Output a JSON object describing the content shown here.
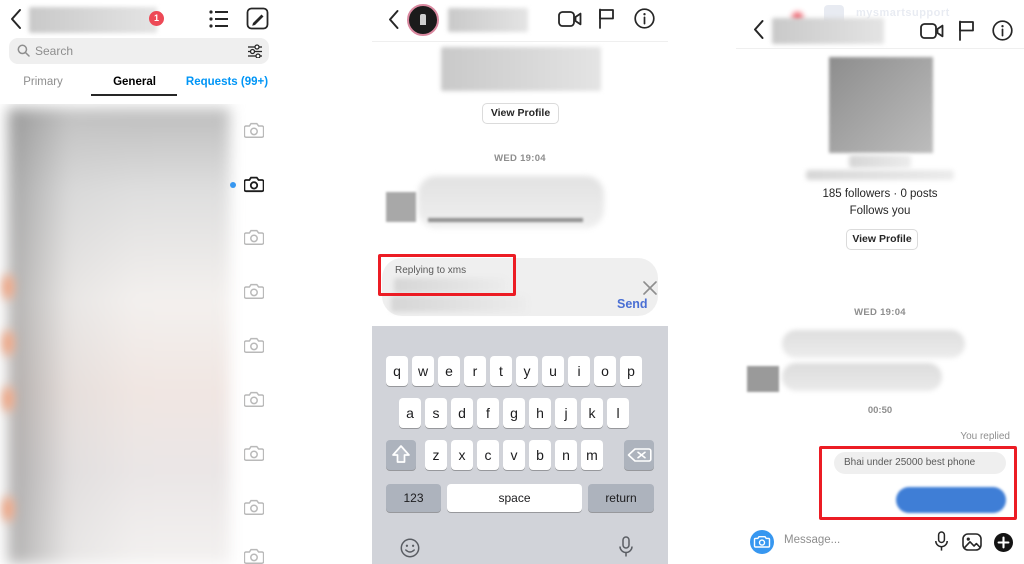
{
  "app": {
    "name": "Instagram Direct Messages",
    "accent_blue": "#0095f6",
    "badge_red": "#ed4956",
    "highlight_red": "#ec1c24",
    "bubble_blue": "#3f7ed6"
  },
  "panel_inbox": {
    "back_icon": "chevron-left-icon",
    "unread_badge": "1",
    "list_icon": "message-requests-list-icon",
    "compose_icon": "compose-pencil-icon",
    "search": {
      "icon": "search-icon",
      "placeholder": "Search",
      "filter_icon": "filter-sliders-icon"
    },
    "tabs": [
      {
        "label": "Primary",
        "selected": false
      },
      {
        "label": "General",
        "selected": true
      },
      {
        "label": "Requests (99+)",
        "selected": false
      }
    ],
    "thread_camera_icon": "camera-icon",
    "unread_dot": "unread-blue-dot"
  },
  "panel_chat": {
    "back_icon": "chevron-left-icon",
    "avatar": "profile-avatar-with-story-ring",
    "video_call_icon": "video-call-icon",
    "flag_icon": "flag-icon",
    "info_icon": "info-circle-icon",
    "view_profile_label": "View Profile",
    "day_stamp": "WED 19:04",
    "composer": {
      "replying_label": "Replying to xms",
      "close_icon": "close-x-icon",
      "send_label": "Send"
    },
    "keyboard": {
      "row1": [
        "q",
        "w",
        "e",
        "r",
        "t",
        "y",
        "u",
        "i",
        "o",
        "p"
      ],
      "row2": [
        "a",
        "s",
        "d",
        "f",
        "g",
        "h",
        "j",
        "k",
        "l"
      ],
      "row3": [
        "z",
        "x",
        "c",
        "v",
        "b",
        "n",
        "m"
      ],
      "shift_icon": "shift-arrow-icon",
      "backspace_icon": "backspace-delete-icon",
      "numeric_label": "123",
      "space_label": "space",
      "return_label": "return",
      "emoji_icon": "emoji-smiley-icon",
      "dictation_icon": "microphone-icon"
    }
  },
  "panel_profile": {
    "watermark_text": "mysmartsupport",
    "back_icon": "chevron-left-icon",
    "video_call_icon": "video-call-icon",
    "flag_icon": "flag-icon",
    "info_icon": "info-circle-icon",
    "stats": "185 followers · 0 posts",
    "relationship": "Follows you",
    "view_profile_label": "View Profile",
    "day_stamp": "WED 19:04",
    "message_time": "00:50",
    "reply_indicator": "You replied",
    "quoted_message": "Bhai under 25000 best phone",
    "input_bar": {
      "camera_icon": "camera-circle-icon",
      "placeholder": "Message...",
      "mic_icon": "microphone-icon",
      "gallery_icon": "photo-gallery-icon",
      "plus_icon": "plus-circle-icon"
    }
  }
}
